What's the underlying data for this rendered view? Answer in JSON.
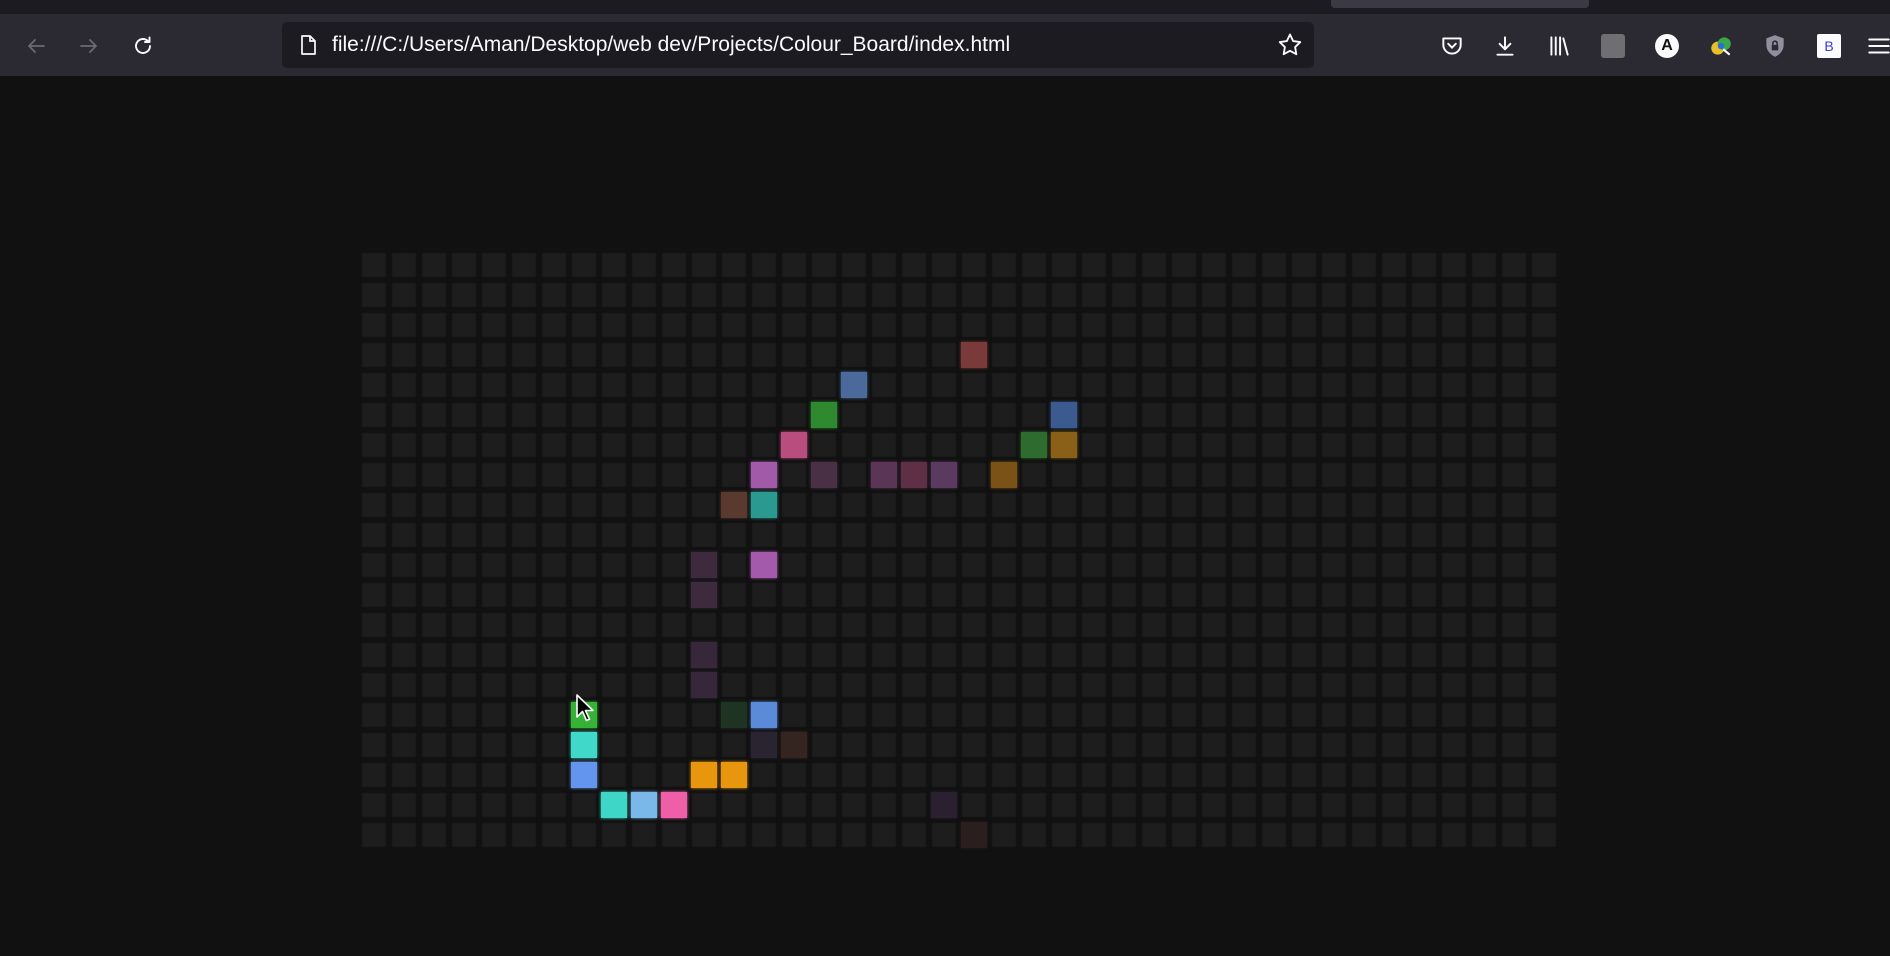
{
  "browser": {
    "url": "file:///C:/Users/Aman/Desktop/web dev/Projects/Colour_Board/index.html",
    "account_letter": "A",
    "extension_letter": "B",
    "icons": [
      "back-icon",
      "forward-icon",
      "reload-icon",
      "page-icon",
      "bookmark-star-icon",
      "pocket-icon",
      "download-icon",
      "library-icon",
      "extension-gray-icon",
      "account-icon",
      "color-picker-extension-icon",
      "shield-lock-icon",
      "extension-b-icon",
      "menu-icon"
    ]
  },
  "board": {
    "columns": 40,
    "rows": 20,
    "default_color": "#1d1d1d",
    "colored_cells": [
      {
        "row": 3,
        "col": 20,
        "color": "#7a3a3a"
      },
      {
        "row": 4,
        "col": 16,
        "color": "#4b6a9b"
      },
      {
        "row": 5,
        "col": 15,
        "color": "#2f8a2f"
      },
      {
        "row": 5,
        "col": 23,
        "color": "#3b5a8f"
      },
      {
        "row": 6,
        "col": 14,
        "color": "#b84d7e"
      },
      {
        "row": 6,
        "col": 22,
        "color": "#2e6b2e"
      },
      {
        "row": 6,
        "col": 23,
        "color": "#8a6018"
      },
      {
        "row": 7,
        "col": 13,
        "color": "#a05aa8"
      },
      {
        "row": 7,
        "col": 15,
        "color": "#4a3045"
      },
      {
        "row": 7,
        "col": 17,
        "color": "#5a3555"
      },
      {
        "row": 7,
        "col": 18,
        "color": "#5e2f45"
      },
      {
        "row": 7,
        "col": 19,
        "color": "#5a3a5e"
      },
      {
        "row": 7,
        "col": 21,
        "color": "#7a5218"
      },
      {
        "row": 8,
        "col": 12,
        "color": "#5a3a2e"
      },
      {
        "row": 8,
        "col": 13,
        "color": "#2a9a90"
      },
      {
        "row": 10,
        "col": 11,
        "color": "#3d2b3d"
      },
      {
        "row": 10,
        "col": 13,
        "color": "#a35aaa"
      },
      {
        "row": 11,
        "col": 11,
        "color": "#3d2b3d"
      },
      {
        "row": 13,
        "col": 11,
        "color": "#36283a"
      },
      {
        "row": 14,
        "col": 11,
        "color": "#36283a"
      },
      {
        "row": 15,
        "col": 7,
        "color": "#36b336"
      },
      {
        "row": 15,
        "col": 12,
        "color": "#1e3322"
      },
      {
        "row": 15,
        "col": 13,
        "color": "#5b8ad8"
      },
      {
        "row": 16,
        "col": 7,
        "color": "#40d8c8"
      },
      {
        "row": 16,
        "col": 13,
        "color": "#2a2430"
      },
      {
        "row": 16,
        "col": 14,
        "color": "#352520"
      },
      {
        "row": 17,
        "col": 7,
        "color": "#6495ed"
      },
      {
        "row": 17,
        "col": 11,
        "color": "#e8960e"
      },
      {
        "row": 17,
        "col": 12,
        "color": "#e8960e"
      },
      {
        "row": 18,
        "col": 8,
        "color": "#3ed6c6"
      },
      {
        "row": 18,
        "col": 9,
        "color": "#7ab8ea"
      },
      {
        "row": 18,
        "col": 10,
        "color": "#ee5fa8"
      },
      {
        "row": 18,
        "col": 19,
        "color": "#2a2030"
      },
      {
        "row": 19,
        "col": 20,
        "color": "#2a1e1e"
      }
    ]
  }
}
